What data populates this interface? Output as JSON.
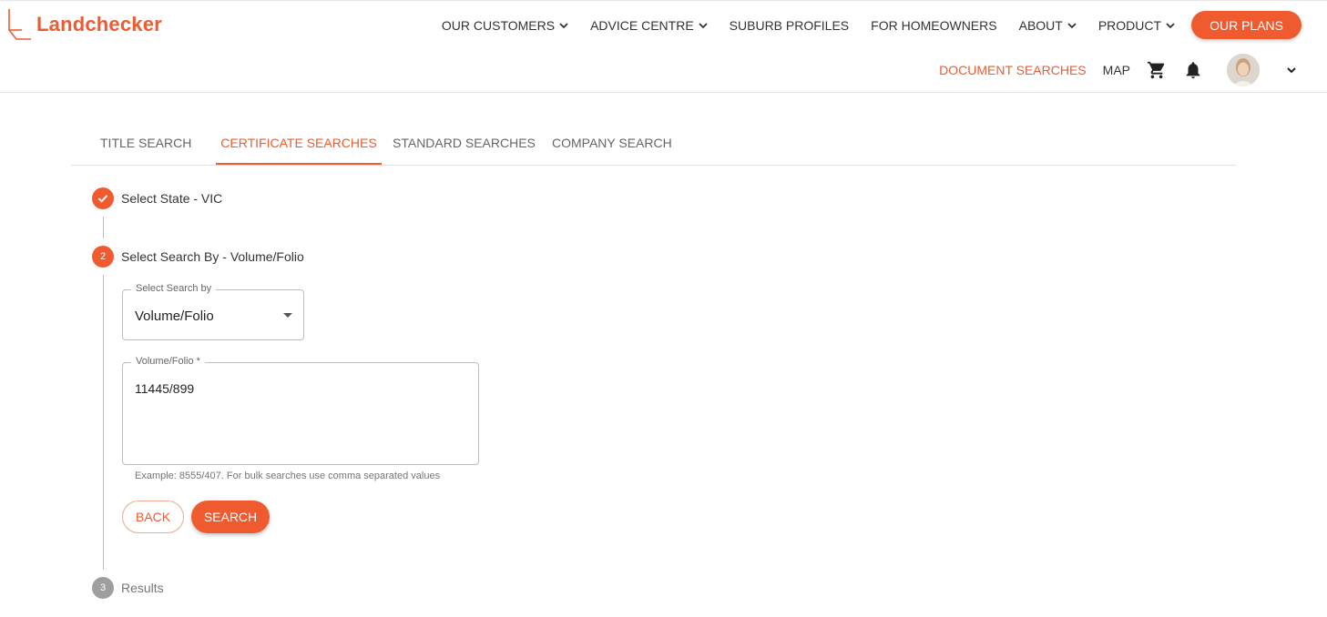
{
  "brand": {
    "name": "Landchecker",
    "color": "#ef5a2f"
  },
  "main_nav": [
    {
      "label": "OUR CUSTOMERS",
      "has_dropdown": true
    },
    {
      "label": "ADVICE CENTRE",
      "has_dropdown": true
    },
    {
      "label": "SUBURB PROFILES",
      "has_dropdown": false
    },
    {
      "label": "FOR HOMEOWNERS",
      "has_dropdown": false
    },
    {
      "label": "ABOUT",
      "has_dropdown": true
    },
    {
      "label": "PRODUCT",
      "has_dropdown": true
    }
  ],
  "plans_button": "OUR PLANS",
  "sub_nav": {
    "document_searches": "DOCUMENT SEARCHES",
    "map": "MAP",
    "icons": [
      "cart-icon",
      "bell-icon",
      "avatar",
      "chevron-down-icon"
    ]
  },
  "tabs": [
    {
      "label": "TITLE SEARCH",
      "active": false
    },
    {
      "label": "CERTIFICATE SEARCHES",
      "active": true
    },
    {
      "label": "STANDARD SEARCHES",
      "active": false
    },
    {
      "label": "COMPANY SEARCH",
      "active": false
    }
  ],
  "steps": [
    {
      "label": "Select State - VIC",
      "status": "completed"
    },
    {
      "number": "2",
      "label": "Select Search By - Volume/Folio",
      "status": "active"
    },
    {
      "number": "3",
      "label": "Results",
      "status": "pending"
    }
  ],
  "form": {
    "search_by": {
      "legend": "Select Search by",
      "value": "Volume/Folio"
    },
    "volume_folio": {
      "legend": "Volume/Folio *",
      "value": "11445/899",
      "helper": "Example: 8555/407. For bulk searches use comma separated values"
    },
    "back_label": "BACK",
    "search_label": "SEARCH"
  }
}
